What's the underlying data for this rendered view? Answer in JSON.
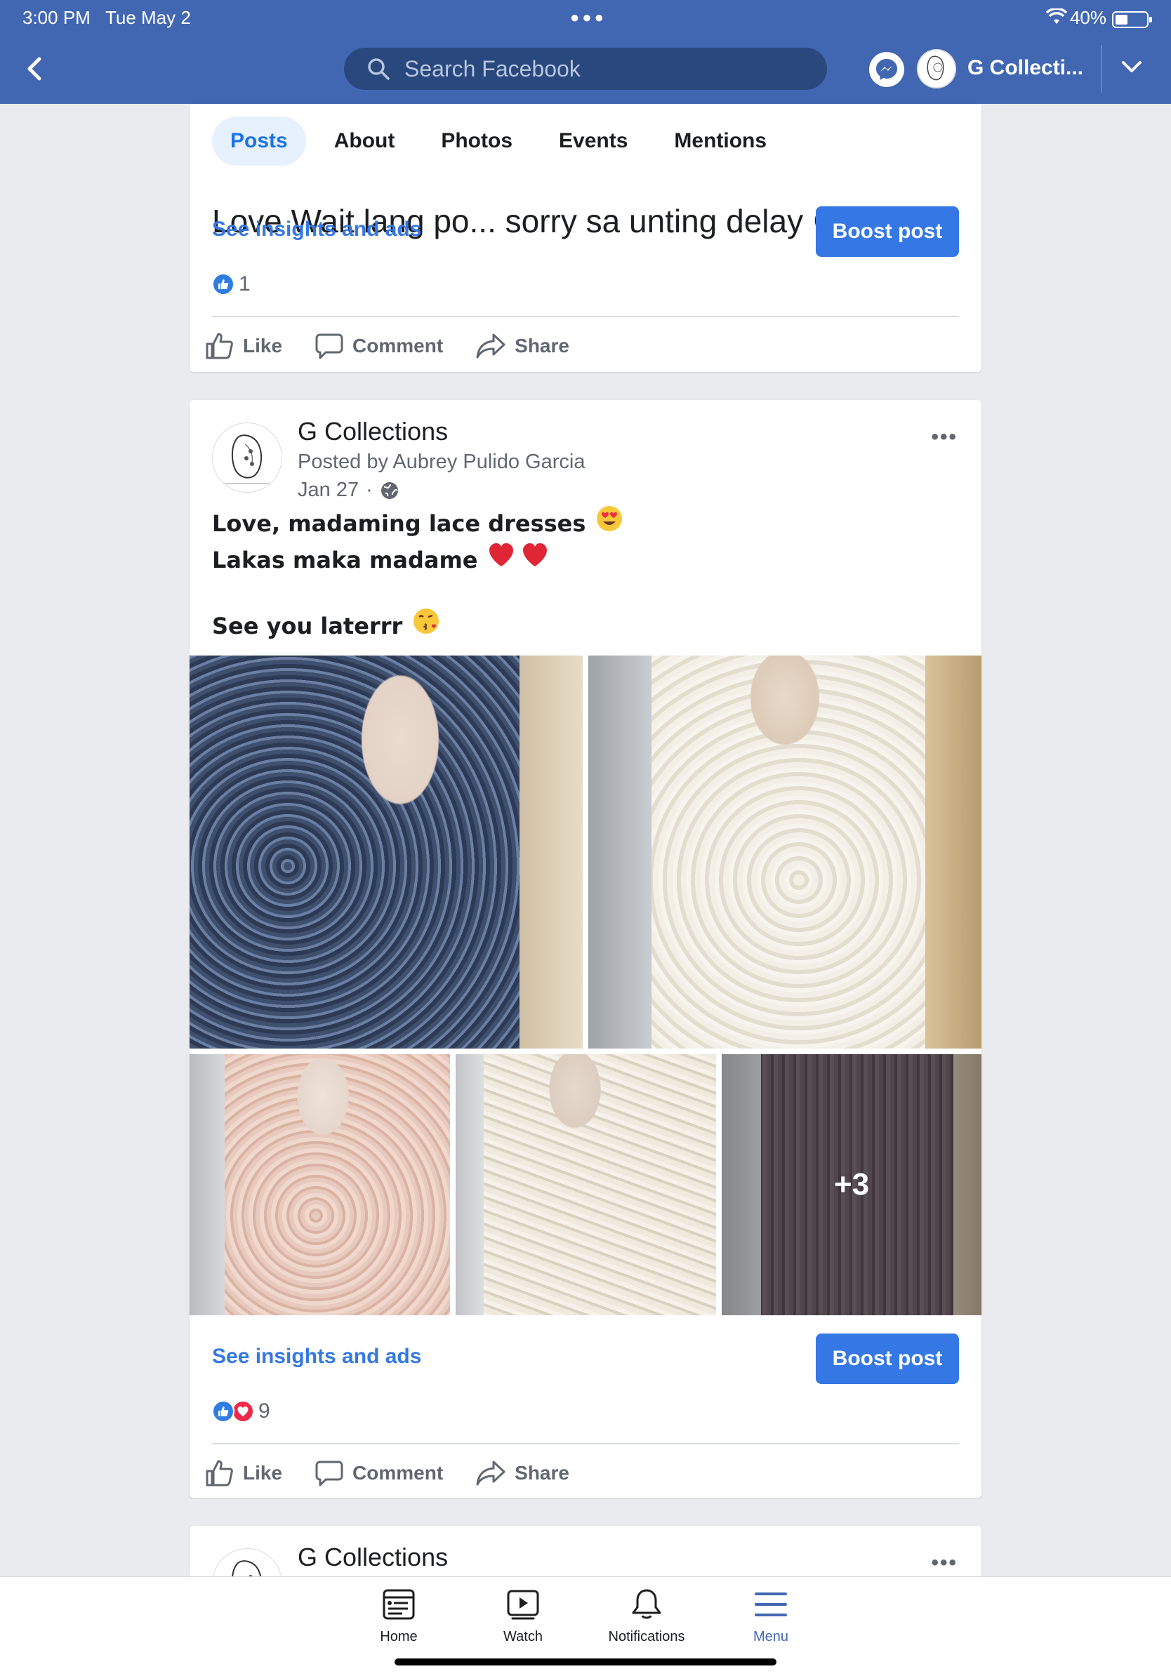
{
  "status_bar": {
    "time": "3:00 PM",
    "date": "Tue May 2",
    "battery": "40%"
  },
  "header": {
    "search_placeholder": "Search Facebook",
    "account_name": "G Collecti..."
  },
  "tabs": [
    {
      "label": "Posts",
      "active": true
    },
    {
      "label": "About",
      "active": false
    },
    {
      "label": "Photos",
      "active": false
    },
    {
      "label": "Events",
      "active": false
    },
    {
      "label": "Mentions",
      "active": false
    }
  ],
  "post1": {
    "cut_text": "Love Wait lang po... sorry sa unting delay 😊",
    "insights": "See insights and ads",
    "boost": "Boost post",
    "reaction_count": "1",
    "actions": {
      "like": "Like",
      "comment": "Comment",
      "share": "Share"
    }
  },
  "post2": {
    "author": "G Collections",
    "posted_by": "Posted by Aubrey Pulido Garcia",
    "date": "Jan 27",
    "lines": [
      "Love, madaming lace dresses",
      "Lakas maka madame",
      "See you laterrr"
    ],
    "more_photos": "+3",
    "insights": "See insights and ads",
    "boost": "Boost post",
    "reaction_count": "9",
    "actions": {
      "like": "Like",
      "comment": "Comment",
      "share": "Share"
    }
  },
  "post3": {
    "author": "G Collections"
  },
  "bottom_nav": [
    {
      "label": "Home",
      "icon": "home-icon",
      "active": false
    },
    {
      "label": "Watch",
      "icon": "watch-icon",
      "active": false
    },
    {
      "label": "Notifications",
      "icon": "bell-icon",
      "active": false
    },
    {
      "label": "Menu",
      "icon": "menu-icon",
      "active": true
    }
  ],
  "colors": {
    "brand": "#4267b2",
    "accent": "#3578e5",
    "love": "#f0284a"
  }
}
